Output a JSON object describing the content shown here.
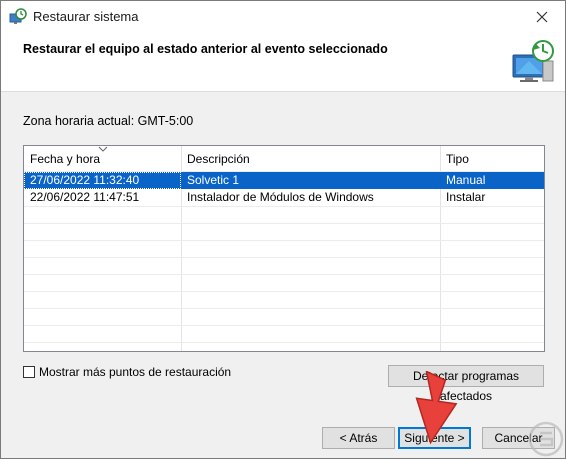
{
  "window": {
    "title": "Restaurar sistema",
    "close_icon": "close-icon"
  },
  "header": {
    "title": "Restaurar el equipo al estado anterior al evento seleccionado",
    "icon": "system-restore-icon"
  },
  "timezone": "Zona horaria actual: GMT-5:00",
  "table": {
    "columns": [
      "Fecha y hora",
      "Descripción",
      "Tipo"
    ],
    "rows": [
      {
        "date": "27/06/2022 11:32:40",
        "description": "Solvetic 1",
        "type": "Manual",
        "selected": true
      },
      {
        "date": "22/06/2022 11:47:51",
        "description": "Instalador de Módulos de Windows",
        "type": "Instalar",
        "selected": false
      }
    ]
  },
  "show_more": {
    "label": "Mostrar más puntos de restauración",
    "checked": false
  },
  "buttons": {
    "detect": "Detectar programas afectados",
    "back": "< Atrás",
    "next": "Siguiente >",
    "cancel": "Cancelar"
  },
  "colors": {
    "selection": "#0a64c8",
    "arrow": "#e8403a"
  }
}
